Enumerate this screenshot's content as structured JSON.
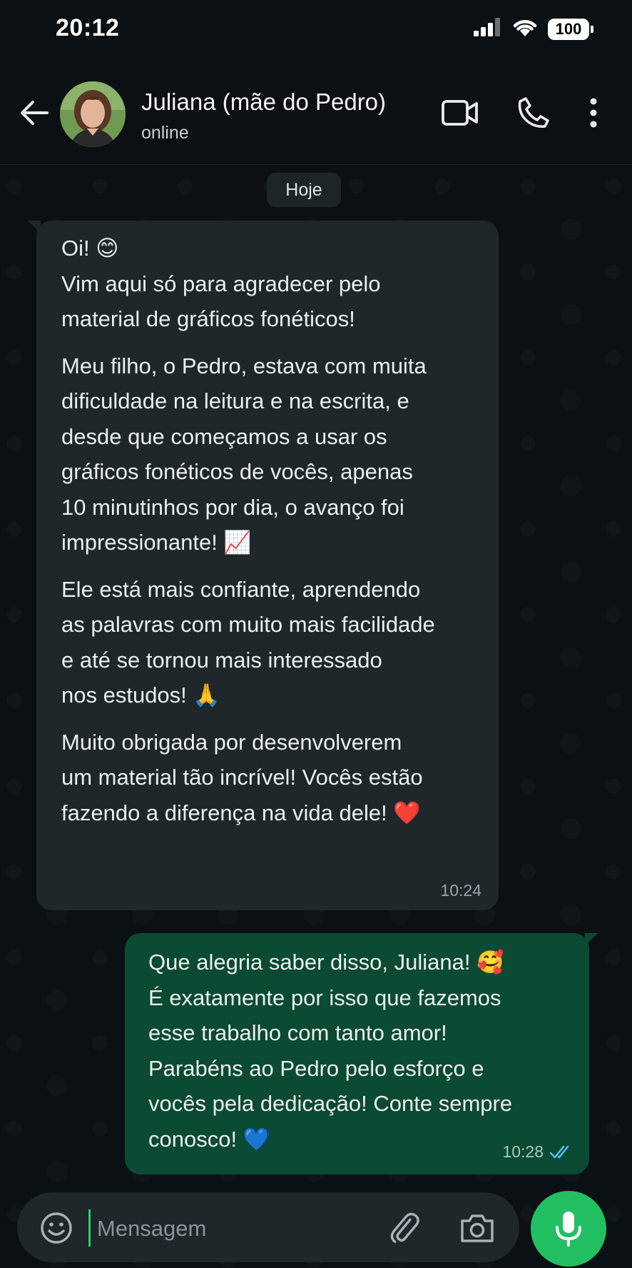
{
  "status_bar": {
    "time": "20:12",
    "battery": "100"
  },
  "header": {
    "contact_name": "Juliana (mãe do Pedro)",
    "contact_status": "online",
    "icons": [
      "back-arrow-icon",
      "video-call-icon",
      "phone-call-icon",
      "more-options-icon"
    ]
  },
  "chat": {
    "date_chip": "Hoje",
    "incoming": {
      "paragraphs": [
        "Oi! 😊\nVim aqui só para agradecer pelo\nmaterial de gráficos fonéticos!",
        "Meu filho, o Pedro, estava com muita\ndificuldade na leitura e na escrita, e\ndesde que começamos a usar os\ngráficos fonéticos de vocês, apenas\n10 minutinhos por dia, o avanço foi\nimpressionante!  📈",
        "Ele está mais confiante, aprendendo\nas palavras com muito mais facilidade\ne até se tornou mais interessado\nnos estudos! 🙏",
        "Muito obrigada por desenvolverem\num material tão incrível! Vocês estão\nfazendo a diferença na vida dele!  ❤️"
      ],
      "time": "10:24"
    },
    "outgoing": {
      "text": "Que alegria saber disso, Juliana! 🥰\nÉ exatamente por isso que fazemos\nesse trabalho com tanto amor!\nParabéns ao Pedro pelo esforço e\nvocês pela dedicação! Conte sempre\nconosco! 💙",
      "time": "10:28",
      "status": "read"
    }
  },
  "composer": {
    "placeholder": "Mensagem",
    "icons": [
      "emoji-icon",
      "attach-clip-icon",
      "camera-icon",
      "microphone-icon"
    ]
  },
  "colors": {
    "background": "#0b1014",
    "incoming_bubble": "#1f272b",
    "outgoing_bubble": "#0b4a33",
    "accent_green": "#21c063",
    "read_ticks": "#53bdeb"
  }
}
